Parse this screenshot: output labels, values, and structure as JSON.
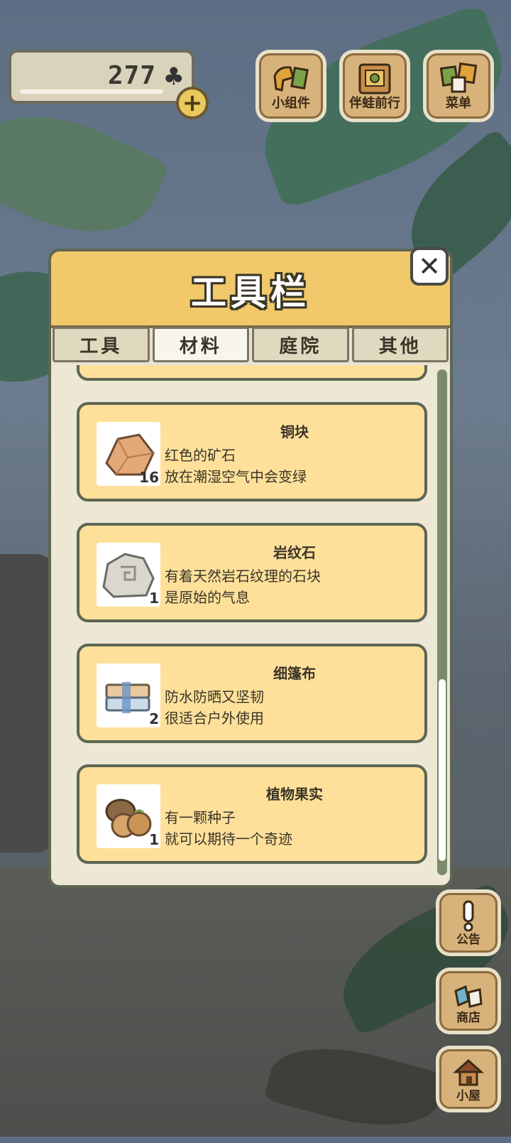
{
  "hud": {
    "clover_count": "277",
    "clover_icon": "clover-icon",
    "add_label": "+",
    "buttons": [
      {
        "label": "小组件",
        "icon": "widget-icon"
      },
      {
        "label": "伴蛙前行",
        "icon": "journey-icon"
      },
      {
        "label": "菜单",
        "icon": "menu-icon"
      }
    ]
  },
  "panel": {
    "title": "工具栏",
    "close_label": "✕",
    "tabs": [
      {
        "label": "工具",
        "active": false
      },
      {
        "label": "材料",
        "active": true
      },
      {
        "label": "庭院",
        "active": false
      },
      {
        "label": "其他",
        "active": false
      }
    ],
    "items": [
      {
        "name": "铜块",
        "qty": "16",
        "desc1": "红色的矿石",
        "desc2": "放在潮湿空气中会变绿",
        "icon": "copper-ore-icon"
      },
      {
        "name": "岩纹石",
        "qty": "1",
        "desc1": "有着天然岩石纹理的石块",
        "desc2": "是原始的气息",
        "icon": "patterned-stone-icon"
      },
      {
        "name": "细篷布",
        "qty": "2",
        "desc1": "防水防晒又坚韧",
        "desc2": "很适合户外使用",
        "icon": "canvas-cloth-icon"
      },
      {
        "name": "植物果实",
        "qty": "1",
        "desc1": "有一颗种子",
        "desc2": "就可以期待一个奇迹",
        "icon": "nut-icon"
      }
    ]
  },
  "side": {
    "buttons": [
      {
        "label": "公告",
        "icon": "notice-icon"
      },
      {
        "label": "商店",
        "icon": "shop-icon"
      },
      {
        "label": "小屋",
        "icon": "house-icon"
      }
    ]
  },
  "colors": {
    "panel_header": "#f1c86a",
    "item_bg": "#ffe09a",
    "button_wood": "#d7b27a"
  }
}
